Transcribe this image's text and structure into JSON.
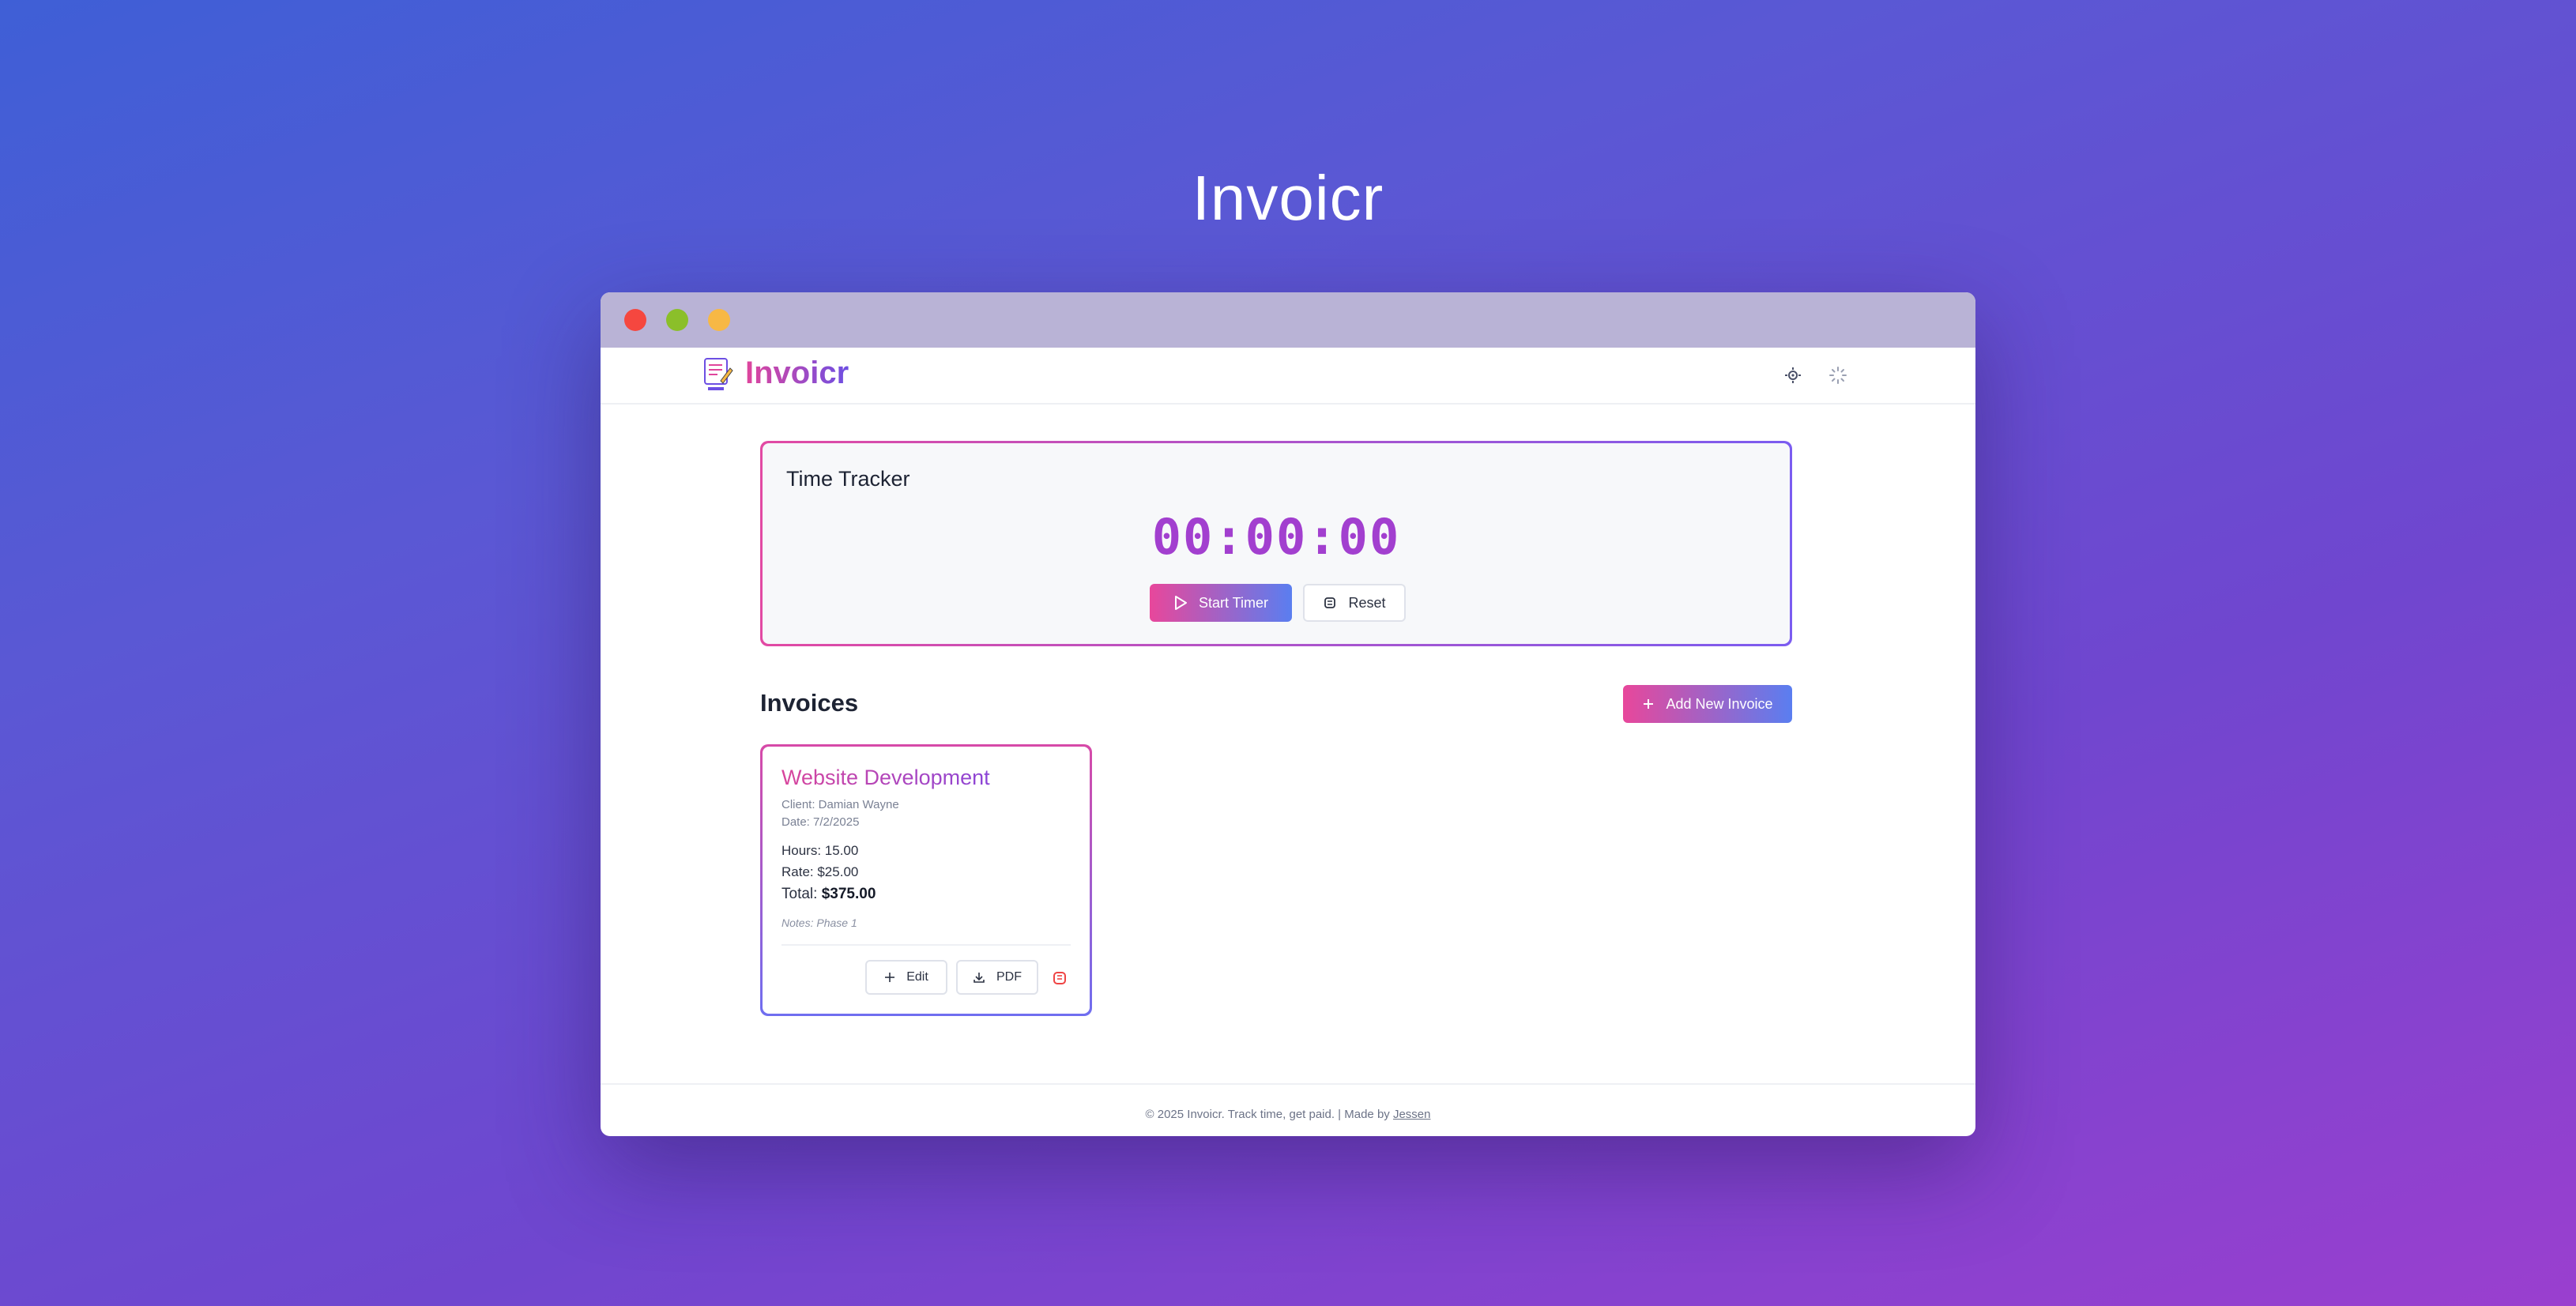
{
  "page": {
    "hero_title": "Invoicr"
  },
  "app": {
    "brand": "Invoicr",
    "logo_icon": "notepad-logo-icon",
    "theme_icon": "sun-icon",
    "loader_icon": "loader-icon"
  },
  "tracker": {
    "title": "Time Tracker",
    "time": "00:00:00",
    "start_label": "Start Timer",
    "reset_label": "Reset"
  },
  "invoices": {
    "heading": "Invoices",
    "add_label": "Add New Invoice",
    "items": [
      {
        "title": "Website Development",
        "client": "Client: Damian Wayne",
        "date": "Date: 7/2/2025",
        "hours": "Hours: 15.00",
        "rate": "Rate: $25.00",
        "total_label": "Total:",
        "total_value": "$375.00",
        "notes": "Notes: Phase 1",
        "edit_label": "Edit",
        "pdf_label": "PDF"
      }
    ]
  },
  "footer": {
    "text": "© 2025 Invoicr. Track time, get paid. | Made by",
    "author": "Jessen"
  },
  "colors": {
    "accent_pink": "#e8479b",
    "accent_blue": "#5a7ef0",
    "timer": "#a23fcf",
    "danger": "#ef4444"
  }
}
